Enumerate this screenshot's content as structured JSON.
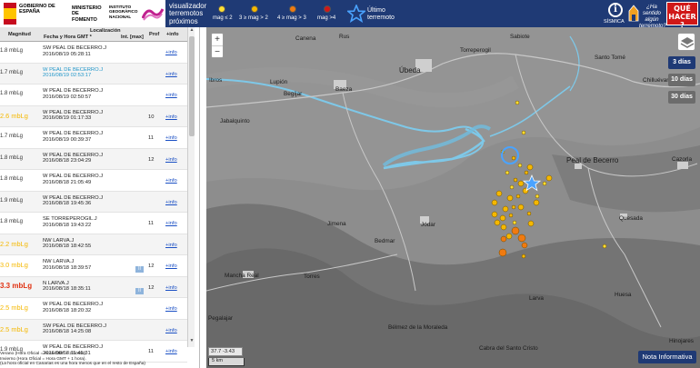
{
  "header": {
    "gov_label": "GOBIERNO DE ESPAÑA",
    "ministry_label": "MINISTERIO DE FOMENTO",
    "ign_label": "INSTITUTO GEOGRÁFICO NACIONAL",
    "visualizer_title": "visualizador terremotos próximos",
    "legend": [
      {
        "label": "mag ≤ 2",
        "color": "#ffe033"
      },
      {
        "label": "3 ≥ mag > 2",
        "color": "#f5b800"
      },
      {
        "label": "4 ≥ mag > 3",
        "color": "#f07a10"
      },
      {
        "label": "mag >4",
        "color": "#d01818"
      }
    ],
    "last_quake_label": "Último terremoto",
    "sismica_label": "SÍSMICA",
    "felt_label": "¿Ha sentido algún terremoto?",
    "que_hacer_label": "QUÉ HACER ?"
  },
  "table": {
    "col_magnitude": "Magnitud",
    "col_location": "Localización",
    "col_datetime": "Fecha y Hora GMT *",
    "col_intensity": "Int. [max]",
    "col_depth": "Prof",
    "col_info": "+info",
    "rows": [
      {
        "mag": "1.8 mbLg",
        "mag_class": "m1",
        "place": "SW PEAL DE BECERRO.J",
        "datetime": "2016/08/19 05:28:11",
        "intensity": "",
        "depth": "",
        "info": "+info",
        "highlight": false
      },
      {
        "mag": "1.7 mbLg",
        "mag_class": "m1",
        "place": "W PEAL DE BECERRO.J",
        "datetime": "2016/08/19 02:53:17",
        "intensity": "",
        "depth": "",
        "info": "+info",
        "highlight": true
      },
      {
        "mag": "1.8 mbLg",
        "mag_class": "m1",
        "place": "W PEAL DE BECERRO.J",
        "datetime": "2016/08/19 02:50:57",
        "intensity": "",
        "depth": "",
        "info": "+info",
        "highlight": false
      },
      {
        "mag": "2.6 mbLg",
        "mag_class": "m2",
        "place": "W PEAL DE BECERRO.J",
        "datetime": "2016/08/19 01:17:33",
        "intensity": "",
        "depth": "10",
        "info": "+info",
        "highlight": false
      },
      {
        "mag": "1.7 mbLg",
        "mag_class": "m1",
        "place": "W PEAL DE BECERRO.J",
        "datetime": "2016/08/19 00:39:37",
        "intensity": "",
        "depth": "11",
        "info": "+info",
        "highlight": false
      },
      {
        "mag": "1.8 mbLg",
        "mag_class": "m1",
        "place": "W PEAL DE BECERRO.J",
        "datetime": "2016/08/18 23:04:29",
        "intensity": "",
        "depth": "12",
        "info": "+info",
        "highlight": false
      },
      {
        "mag": "1.8 mbLg",
        "mag_class": "m1",
        "place": "W PEAL DE BECERRO.J",
        "datetime": "2016/08/18 21:05:49",
        "intensity": "",
        "depth": "",
        "info": "+info",
        "highlight": false
      },
      {
        "mag": "1.9 mbLg",
        "mag_class": "m1",
        "place": "W PEAL DE BECERRO.J",
        "datetime": "2016/08/18 19:45:36",
        "intensity": "",
        "depth": "",
        "info": "+info",
        "highlight": false
      },
      {
        "mag": "1.8 mbLg",
        "mag_class": "m1",
        "place": "SE TORREPEROGIL.J",
        "datetime": "2016/08/18 19:43:22",
        "intensity": "",
        "depth": "11",
        "info": "+info",
        "highlight": false
      },
      {
        "mag": "2.2 mbLg",
        "mag_class": "m2",
        "place": "NW LARVA.J",
        "datetime": "2016/08/18 18:42:55",
        "intensity": "",
        "depth": "",
        "info": "+info",
        "highlight": false
      },
      {
        "mag": "3.0 mbLg",
        "mag_class": "m2",
        "place": "NW LARVA.J",
        "datetime": "2016/08/18 18:39:57",
        "intensity": "II",
        "depth": "12",
        "info": "+info",
        "highlight": false
      },
      {
        "mag": "3.3 mbLg",
        "mag_class": "m3",
        "place": "N LARVA.J",
        "datetime": "2016/08/18 18:35:11",
        "intensity": "II",
        "depth": "12",
        "info": "+info",
        "highlight": false
      },
      {
        "mag": "2.5 mbLg",
        "mag_class": "m2",
        "place": "W PEAL DE BECERRO.J",
        "datetime": "2016/08/18 18:20:32",
        "intensity": "",
        "depth": "",
        "info": "+info",
        "highlight": false
      },
      {
        "mag": "2.5 mbLg",
        "mag_class": "m2",
        "place": "SW PEAL DE BECERRO.J",
        "datetime": "2016/08/18 14:25:08",
        "intensity": "",
        "depth": "",
        "info": "+info",
        "highlight": false
      },
      {
        "mag": "1.9 mbLg",
        "mag_class": "m1",
        "place": "W PEAL DE BECERRO.J",
        "datetime": "2016/08/18 11:45:31",
        "intensity": "",
        "depth": "11",
        "info": "+info",
        "highlight": false
      }
    ],
    "mag_colors": {
      "m1": "#333333",
      "m2": "#f5b800",
      "m3": "#e03010"
    },
    "footnote": [
      "Verano (Hora Oficial = Hora GMT + 2 horas).",
      "Invierno (Hora Oficial = Hora GMT + 1 hora).",
      "(La hora oficial en Canarias es una hora menos que en el resto de España)"
    ]
  },
  "map": {
    "range_buttons": [
      "3 días",
      "10 días",
      "30 días"
    ],
    "active_range": "3 días",
    "coords": "37.7  -3.43",
    "scale": "5 km",
    "nota_button": "Nota Informativa",
    "places": {
      "ubeda": "Úbeda",
      "baeza": "Baeza",
      "begijar": "Begíjar",
      "lupion": "Lupión",
      "torreperogil": "Torreperogil",
      "santo_tome": "Santo Tomé",
      "chilluevar": "Chilluévar",
      "peal": "Peal de Becerro",
      "cazorla": "Cazorla",
      "jodar": "Jódar",
      "bedmar": "Bedmar",
      "quesada": "Quesada",
      "albanchez": "Albanchez de Mágina",
      "mancha_real": "Mancha Real",
      "torres": "Torres",
      "larva": "Larva",
      "huesa": "Huesa",
      "jimena": "Jimena",
      "pegalajar": "Pegalajar",
      "belmez": "Bélmez de la Moraleda",
      "cabra": "Cabra del Santo Cristo",
      "hinojares": "Hinojares",
      "canena": "Canena",
      "rus": "Rus",
      "ibros": "Ibros",
      "sabiote": "Sabiote",
      "jabalquinto": "Jabalquinto"
    }
  }
}
